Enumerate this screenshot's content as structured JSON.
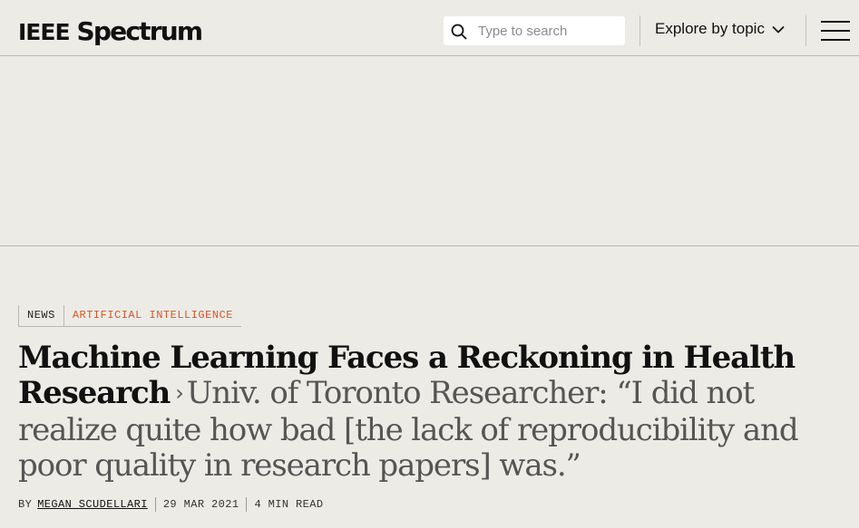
{
  "header": {
    "logo_ieee": "IEEE",
    "logo_spectrum": "Spectrum",
    "search_placeholder": "Type to search",
    "explore_label": "Explore by topic"
  },
  "article": {
    "tags": [
      "NEWS",
      "ARTIFICIAL INTELLIGENCE"
    ],
    "title": "Machine Learning Faces a Reckoning in Health Research",
    "separator": "›",
    "subtitle": "Univ. of Toronto Researcher: “I did not realize quite how bad [the lack of reproducibility and poor quality in research papers] was.”",
    "byline_prefix": "BY",
    "author": "MEGAN SCUDELLARI",
    "date": "29 MAR 2021",
    "read_time": "4 MIN READ"
  },
  "colors": {
    "background": "#ecebe6",
    "accent_tag": "#e0531d",
    "subtitle_gray": "#555555"
  },
  "icons": {
    "search": "search-icon",
    "chevron": "chevron-down-icon",
    "menu": "hamburger-menu-icon"
  }
}
